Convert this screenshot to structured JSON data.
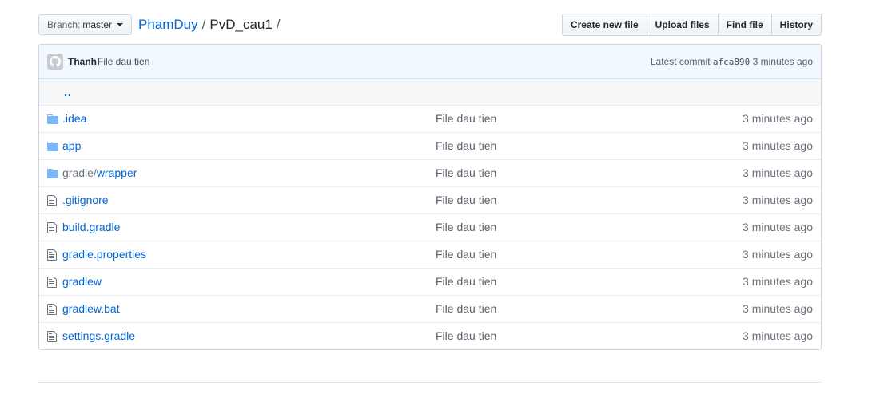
{
  "toolbar": {
    "branch_prefix": "Branch:",
    "branch_name": "master",
    "buttons": {
      "create": "Create new file",
      "upload": "Upload files",
      "find": "Find file",
      "history": "History"
    }
  },
  "breadcrumb": {
    "repo": "PhamDuy",
    "separator": "/",
    "folder": "PvD_cau1",
    "trailing": "/"
  },
  "commit": {
    "author": "Thanh",
    "message": "File dau tien",
    "latest_label": "Latest commit",
    "sha": "afca890",
    "age": "3 minutes ago"
  },
  "parent_link": "..",
  "files": [
    {
      "type": "folder",
      "name": ".idea",
      "message": "File dau tien",
      "age": "3 minutes ago"
    },
    {
      "type": "folder",
      "name": "app",
      "message": "File dau tien",
      "age": "3 minutes ago"
    },
    {
      "type": "folder",
      "name_dir": "gradle/",
      "name": "wrapper",
      "message": "File dau tien",
      "age": "3 minutes ago"
    },
    {
      "type": "file",
      "name": ".gitignore",
      "message": "File dau tien",
      "age": "3 minutes ago"
    },
    {
      "type": "file",
      "name": "build.gradle",
      "message": "File dau tien",
      "age": "3 minutes ago"
    },
    {
      "type": "file",
      "name": "gradle.properties",
      "message": "File dau tien",
      "age": "3 minutes ago"
    },
    {
      "type": "file",
      "name": "gradlew",
      "message": "File dau tien",
      "age": "3 minutes ago"
    },
    {
      "type": "file",
      "name": "gradlew.bat",
      "message": "File dau tien",
      "age": "3 minutes ago"
    },
    {
      "type": "file",
      "name": "settings.gradle",
      "message": "File dau tien",
      "age": "3 minutes ago"
    }
  ],
  "colors": {
    "link": "#0366d6",
    "commit_bar_bg": "#f1f8ff",
    "folder_icon": "#79b8ff"
  }
}
